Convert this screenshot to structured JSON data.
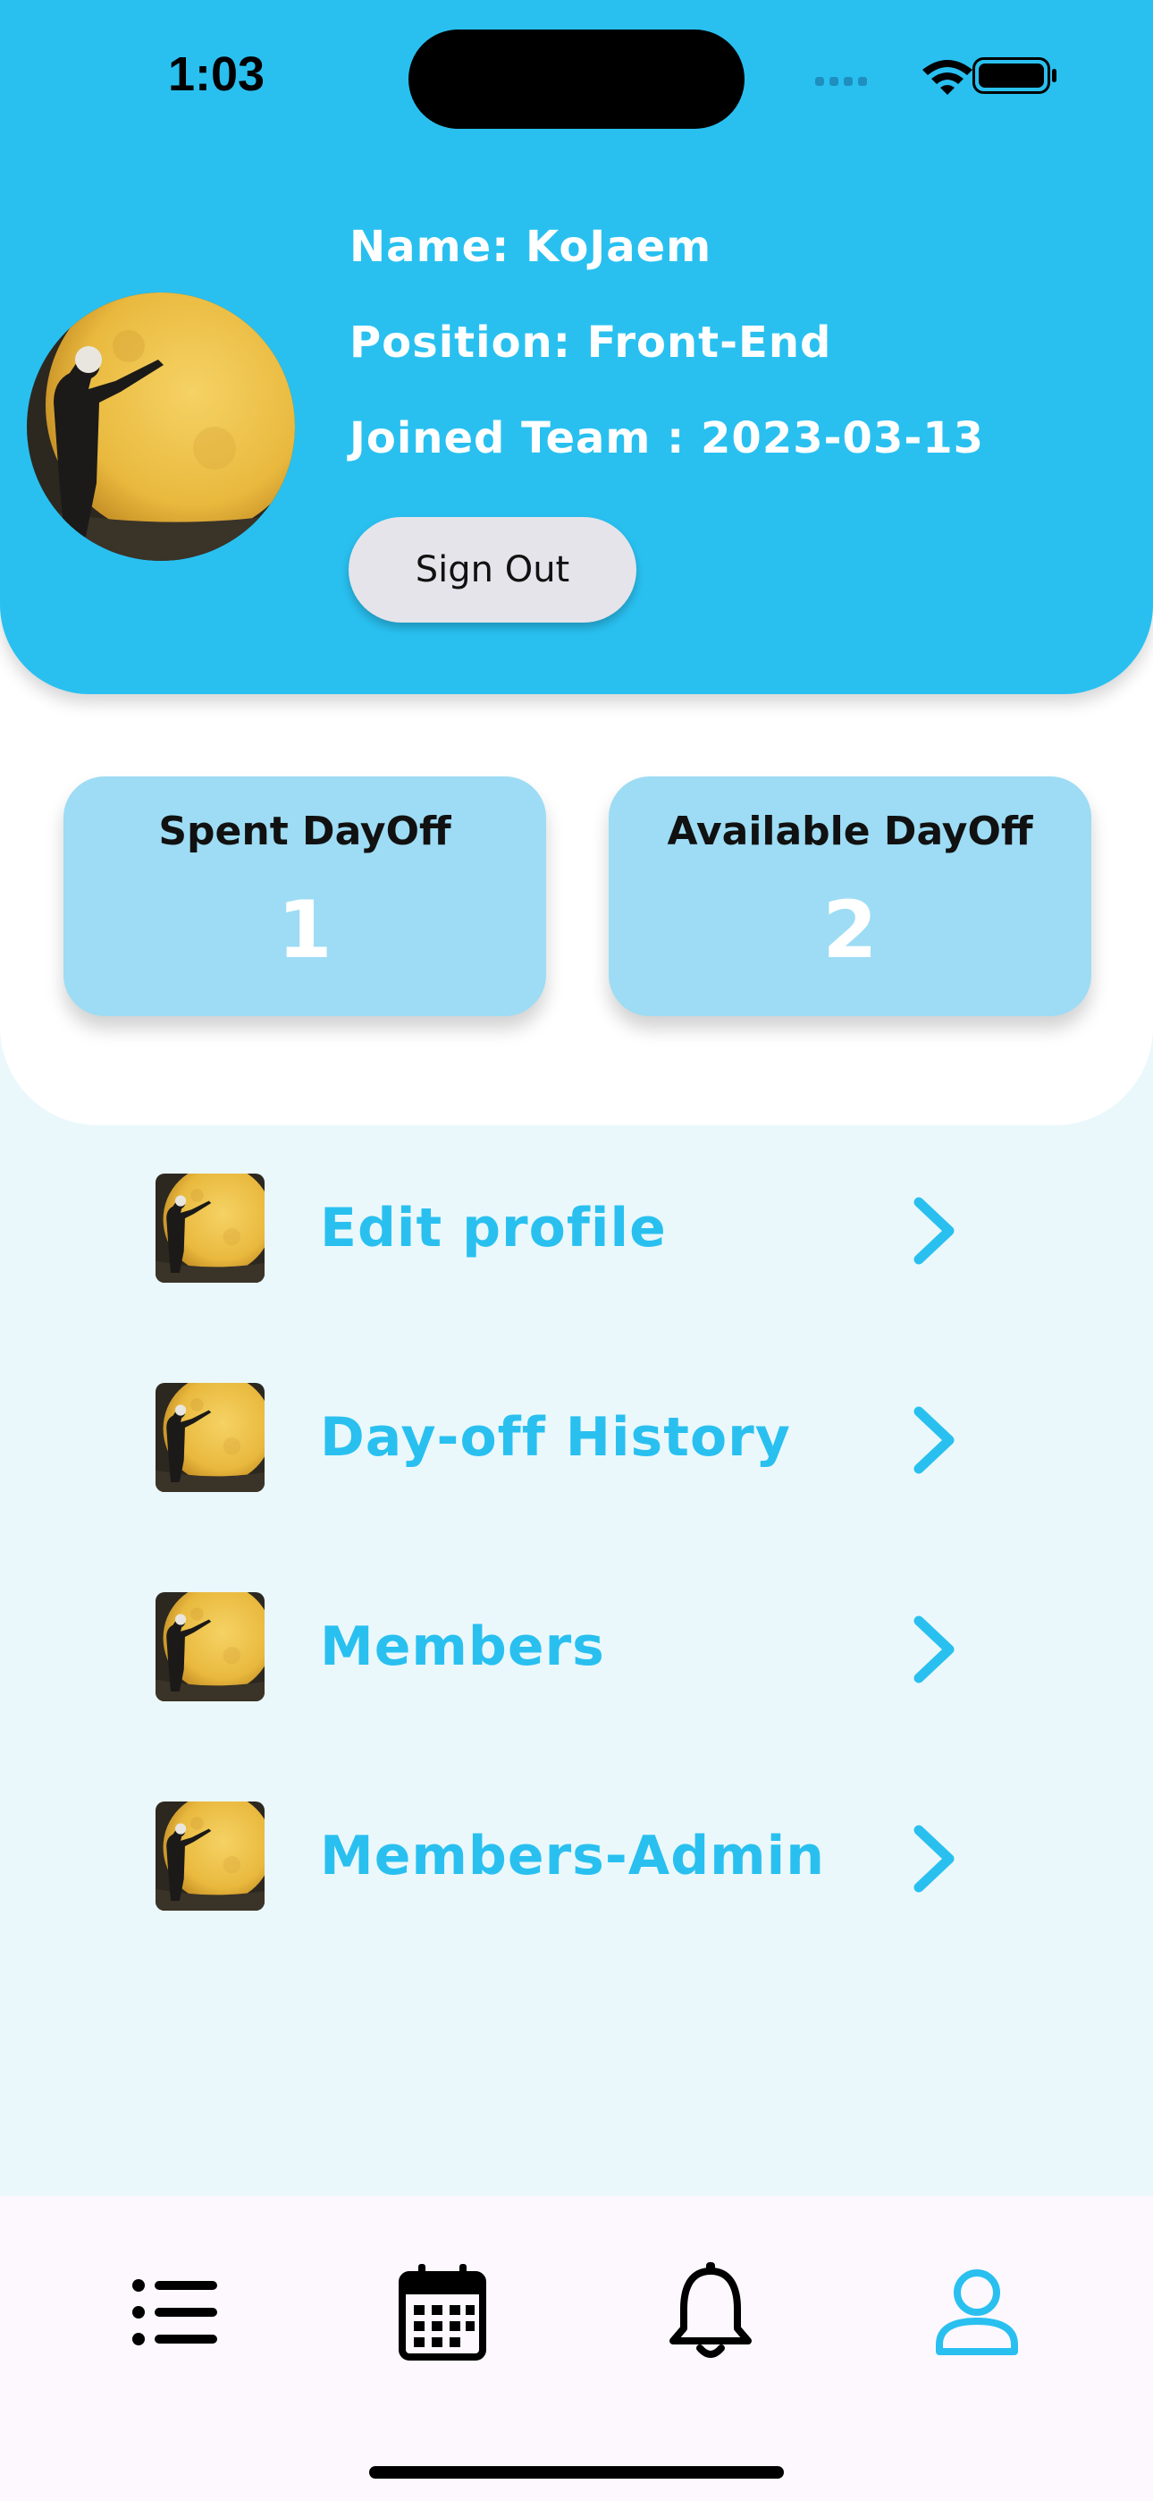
{
  "status_bar": {
    "time": "1:03"
  },
  "profile": {
    "name_line": "Name: KoJaem",
    "position_line": "Position: Front-End",
    "joined_line": "Joined Team : 2023-03-13",
    "sign_out_label": "Sign Out"
  },
  "stats": {
    "spent": {
      "label": "Spent DayOff",
      "value": "1"
    },
    "available": {
      "label": "Available DayOff",
      "value": "2"
    }
  },
  "menu": [
    {
      "label": "Edit profile",
      "icon": "moon-photo-thumbnail"
    },
    {
      "label": "Day-off History",
      "icon": "moon-photo-thumbnail"
    },
    {
      "label": "Members",
      "icon": "moon-photo-thumbnail"
    },
    {
      "label": "Members-Admin",
      "icon": "moon-photo-thumbnail"
    }
  ],
  "bottom_nav": {
    "items": [
      {
        "icon": "list-icon",
        "active": false
      },
      {
        "icon": "calendar-icon",
        "active": false
      },
      {
        "icon": "bell-icon",
        "active": false
      },
      {
        "icon": "profile-icon",
        "active": true
      }
    ]
  },
  "colors": {
    "primary": "#29c0f0",
    "card": "#9ddcf4",
    "page_background": "#eaf8fc",
    "button_grey": "#e5e4ea"
  }
}
